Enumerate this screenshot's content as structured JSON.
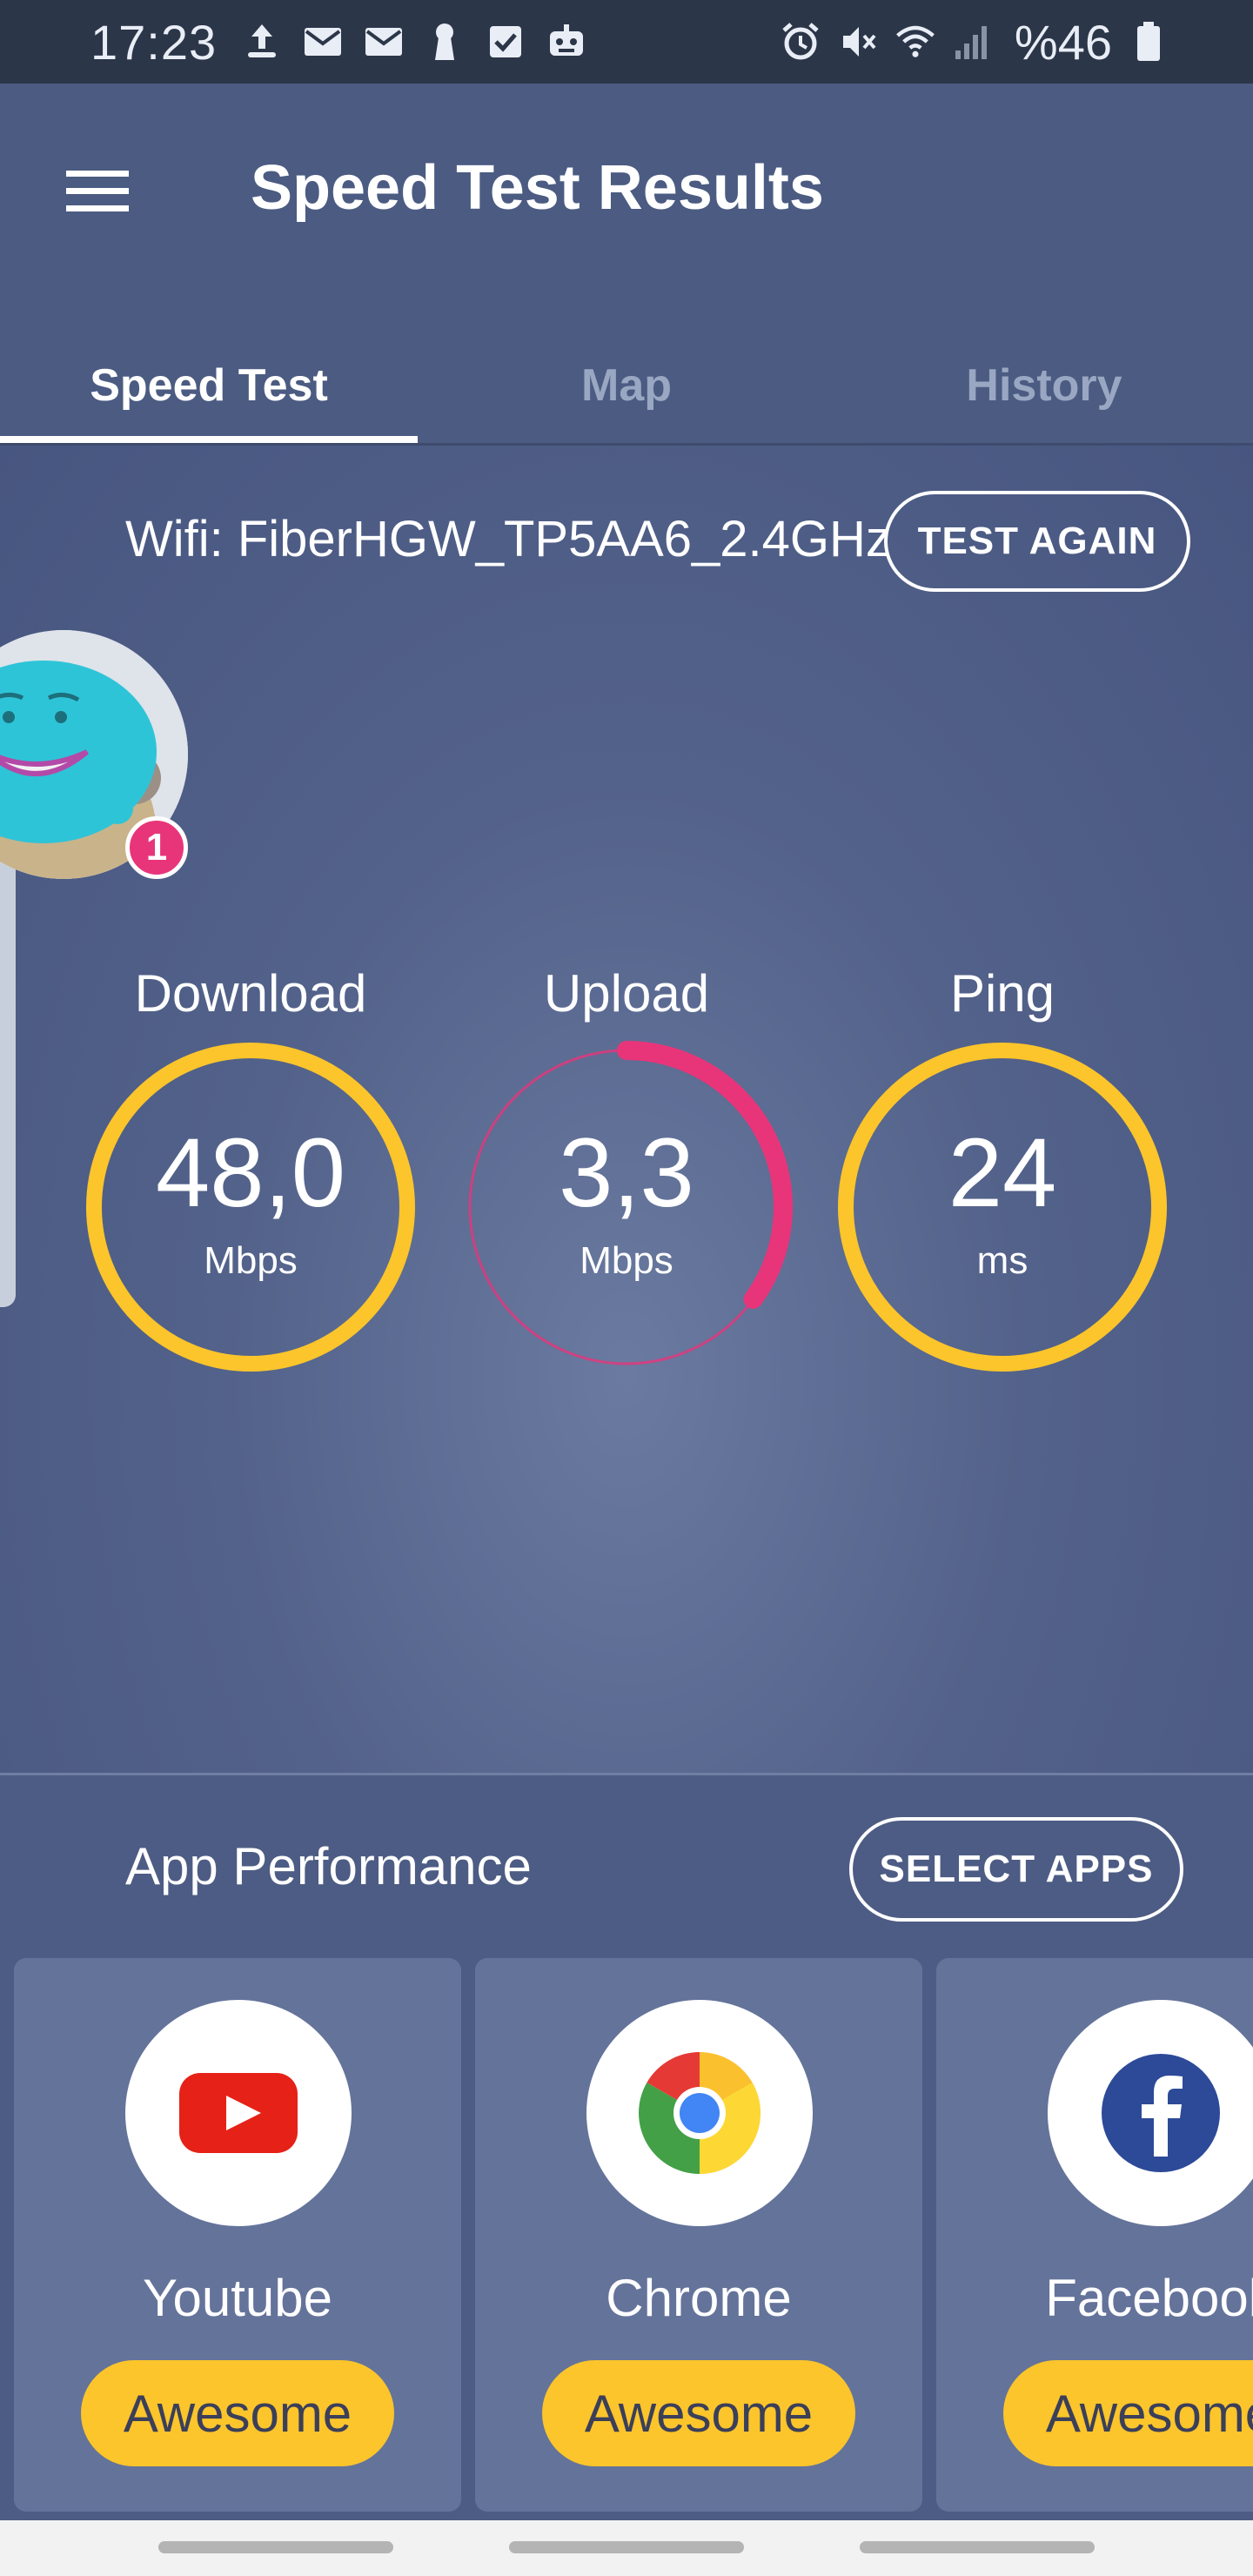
{
  "status_bar": {
    "time": "17:23",
    "notification_icons": [
      "upload-icon",
      "mail-icon",
      "mail-icon",
      "keyhole-icon",
      "checkbox-icon",
      "robot-icon"
    ],
    "system_icons": [
      "alarm-icon",
      "mute-icon",
      "wifi-icon",
      "signal-icon"
    ],
    "battery": "%46"
  },
  "app_bar": {
    "title": "Speed Test Results",
    "menu_icon": "hamburger-menu-icon"
  },
  "tabs": [
    {
      "label": "Speed Test",
      "active": true
    },
    {
      "label": "Map",
      "active": false
    },
    {
      "label": "History",
      "active": false
    }
  ],
  "connection": {
    "label": "Wifi: FiberHGW_TP5AA6_2.4GHz",
    "test_again_label": "TEST AGAIN"
  },
  "mascot": {
    "badge_count": "1"
  },
  "metrics": [
    {
      "title": "Download",
      "value": "48,0",
      "unit": "Mbps",
      "color": "#fbc52b",
      "fill_fraction": 1.0
    },
    {
      "title": "Upload",
      "value": "3,3",
      "unit": "Mbps",
      "color": "#e8357a",
      "fill_fraction": 0.35
    },
    {
      "title": "Ping",
      "value": "24",
      "unit": "ms",
      "color": "#fbc52b",
      "fill_fraction": 1.0
    }
  ],
  "app_performance": {
    "title": "App Performance",
    "select_apps_label": "SELECT APPS",
    "apps": [
      {
        "name": "Youtube",
        "rating": "Awesome",
        "icon": "youtube-icon"
      },
      {
        "name": "Chrome",
        "rating": "Awesome",
        "icon": "chrome-icon"
      },
      {
        "name": "Facebook",
        "rating": "Awesome",
        "icon": "facebook-icon"
      }
    ]
  },
  "colors": {
    "background": "#4b5b82",
    "accent_yellow": "#fbc52b",
    "accent_pink": "#e8357a"
  }
}
